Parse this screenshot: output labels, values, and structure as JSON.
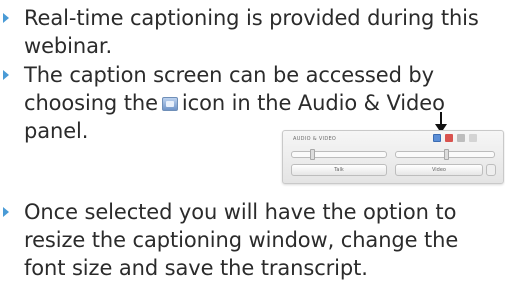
{
  "bullets": [
    {
      "lines": [
        "Real-time captioning is provided during this",
        "webinar."
      ]
    },
    {
      "line1": "The caption screen can be accessed by",
      "line2_before": "choosing the",
      "line2_after": "icon in the Audio & Video",
      "line3": "panel.",
      "icon": "closed-caption-icon"
    },
    {
      "lines": [
        "Once selected you will have the option to",
        "resize the captioning window, change the",
        "font size and save the transcript."
      ]
    }
  ],
  "panel": {
    "title": "AUDIO & VIDEO",
    "button_left": "Talk",
    "button_right": "Video"
  },
  "colors": {
    "bullet": "#4a9bd6",
    "text": "#2b2b2b"
  }
}
